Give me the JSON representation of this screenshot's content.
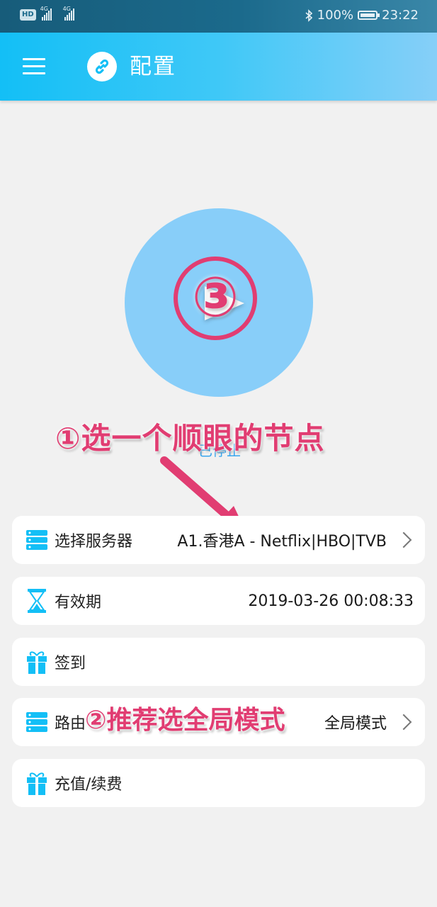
{
  "status_bar": {
    "hd": "HD",
    "net1": "4G",
    "net2": "4G",
    "battery": "100%",
    "time": "23:22"
  },
  "app_bar": {
    "menu_icon": "hamburger-menu-icon",
    "app_icon": "link-icon",
    "title": "配置"
  },
  "connect": {
    "button_icon": "play-icon",
    "status_text": "已停止"
  },
  "annotations": {
    "step3": "③",
    "step1": "①选一个顺眼的节点",
    "step2": "②推荐选全局模式"
  },
  "rows": [
    {
      "icon": "server-icon",
      "label": "选择服务器",
      "value": "A1.香港A - Netflix|HBO|TVB",
      "chevron": true
    },
    {
      "icon": "hourglass-icon",
      "label": "有效期",
      "value": "2019-03-26 00:08:33",
      "chevron": false
    },
    {
      "icon": "gift-icon",
      "label": "签到",
      "value": "",
      "chevron": false
    },
    {
      "icon": "server-icon",
      "label": "路由",
      "value": "全局模式",
      "chevron": true
    },
    {
      "icon": "gift-icon",
      "label": "充值/续费",
      "value": "",
      "chevron": false
    }
  ],
  "colors": {
    "accent": "#13bff6",
    "annotation": "#e13d72",
    "circle": "#88cef9"
  }
}
